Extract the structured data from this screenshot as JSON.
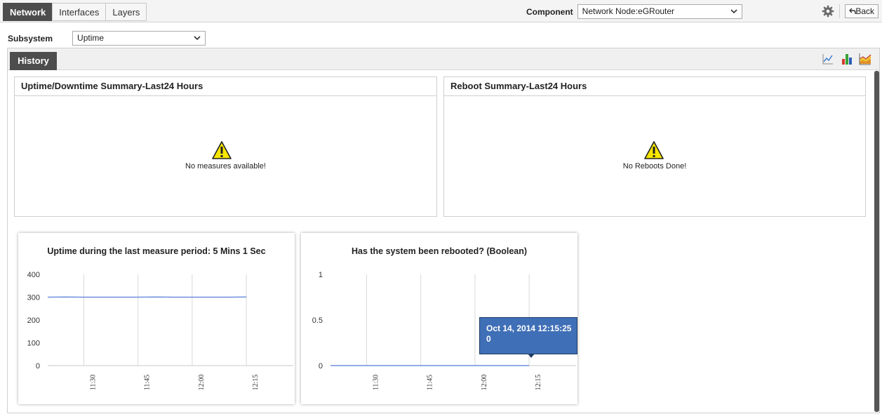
{
  "tabs": [
    {
      "label": "Network",
      "active": true
    },
    {
      "label": "Interfaces",
      "active": false
    },
    {
      "label": "Layers",
      "active": false
    }
  ],
  "component": {
    "label": "Component",
    "value": "Network Node:eGRouter"
  },
  "toolbar": {
    "back_label": "Back",
    "settings_icon": "gear-icon"
  },
  "subsystem": {
    "label": "Subsystem",
    "value": "Uptime"
  },
  "history": {
    "tab_label": "History",
    "icons": [
      "line-chart-icon",
      "bar-chart-icon",
      "trend-chart-icon"
    ]
  },
  "summaries": [
    {
      "title": "Uptime/Downtime Summary-Last24 Hours",
      "message": "No measures available!"
    },
    {
      "title": "Reboot Summary-Last24 Hours",
      "message": "No Reboots Done!"
    }
  ],
  "chart_data": [
    {
      "type": "line",
      "title": "Uptime during the last measure period: 5 Mins 1 Sec",
      "x_ticks": [
        "11:30",
        "11:45",
        "12:00",
        "12:15"
      ],
      "y_ticks": [
        "0",
        "100",
        "200",
        "300",
        "400"
      ],
      "ylim": [
        0,
        400
      ],
      "x_range": [
        "11:20",
        "12:28"
      ],
      "series": [
        {
          "x": [
            "11:20",
            "11:25",
            "11:30",
            "11:35",
            "11:40",
            "11:45",
            "11:50",
            "11:55",
            "12:00",
            "12:05",
            "12:10",
            "12:15"
          ],
          "values": [
            300,
            301,
            300,
            300,
            300,
            300,
            301,
            300,
            300,
            300,
            300,
            301
          ]
        }
      ],
      "grid": "vertical",
      "color": "#6f8fde"
    },
    {
      "type": "line",
      "title": "Has the system been rebooted? (Boolean)",
      "x_ticks": [
        "11:30",
        "11:45",
        "12:00",
        "12:15"
      ],
      "y_ticks": [
        "0",
        "0.5",
        "1"
      ],
      "ylim": [
        0,
        1
      ],
      "x_range": [
        "11:20",
        "12:28"
      ],
      "series": [
        {
          "x": [
            "11:20",
            "11:25",
            "11:30",
            "11:35",
            "11:40",
            "11:45",
            "11:50",
            "11:55",
            "12:00",
            "12:05",
            "12:10",
            "12:15"
          ],
          "values": [
            0,
            0,
            0,
            0,
            0,
            0,
            0,
            0,
            0,
            0,
            0,
            0
          ]
        }
      ],
      "grid": "vertical",
      "color": "#6f8fde",
      "tooltip": {
        "date": "Oct 14, 2014 12:15:25",
        "value": "0"
      }
    }
  ]
}
